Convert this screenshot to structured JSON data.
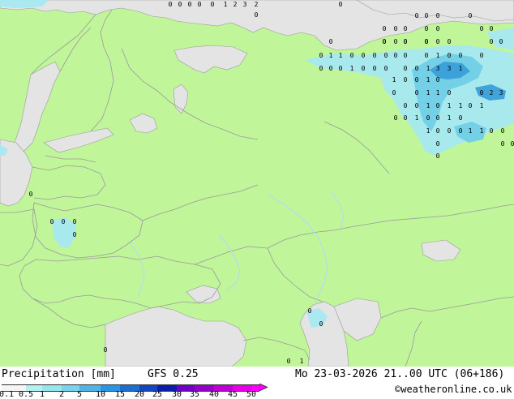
{
  "map": {
    "title": "Precipitation [mm]",
    "model": "GFS 0.25",
    "valid_time": "Mo 23-03-2026 21..00 UTC (06+186)",
    "credit": "©weatheronline.co.uk",
    "colors": {
      "land": "#c0f59a",
      "sea": "#e4e4e4",
      "border": "#9a9a9a",
      "river": "#b4d8ff",
      "precip_light": "#a6e8f2",
      "precip_medium": "#70cfe6",
      "precip_heavy": "#3a9fd8"
    },
    "value_labels": [
      {
        "t": "0"
      },
      {
        "t": "0"
      },
      {
        "t": "0"
      },
      {
        "t": "0"
      },
      {
        "t": "0"
      },
      {
        "t": "1"
      },
      {
        "t": "2"
      },
      {
        "t": "3"
      },
      {
        "t": "2"
      },
      {
        "t": "0"
      },
      {
        "t": "0"
      },
      {
        "t": "0"
      },
      {
        "t": "0"
      },
      {
        "t": "0"
      },
      {
        "t": "0"
      },
      {
        "t": "0"
      },
      {
        "t": "0"
      },
      {
        "t": "0"
      },
      {
        "t": "0"
      },
      {
        "t": "0"
      },
      {
        "t": "0"
      },
      {
        "t": "0"
      },
      {
        "t": "0"
      },
      {
        "t": "0"
      },
      {
        "t": "0"
      },
      {
        "t": "0"
      },
      {
        "t": "0"
      },
      {
        "t": "0"
      },
      {
        "t": "0"
      },
      {
        "t": "0"
      },
      {
        "t": "0"
      },
      {
        "t": "0"
      },
      {
        "t": "0"
      },
      {
        "t": "0"
      },
      {
        "t": "0"
      },
      {
        "t": "1"
      },
      {
        "t": "1"
      },
      {
        "t": "0"
      },
      {
        "t": "0"
      },
      {
        "t": "0"
      },
      {
        "t": "0"
      },
      {
        "t": "0"
      },
      {
        "t": "0"
      },
      {
        "t": "0"
      },
      {
        "t": "1"
      },
      {
        "t": "0"
      },
      {
        "t": "0"
      },
      {
        "t": "0"
      },
      {
        "t": "0"
      },
      {
        "t": "0"
      },
      {
        "t": "0"
      },
      {
        "t": "1"
      },
      {
        "t": "0"
      },
      {
        "t": "0"
      },
      {
        "t": "0"
      },
      {
        "t": "0"
      },
      {
        "t": "0"
      },
      {
        "t": "1"
      },
      {
        "t": "3"
      },
      {
        "t": "3"
      },
      {
        "t": "1"
      },
      {
        "t": "1"
      },
      {
        "t": "0"
      },
      {
        "t": "0"
      },
      {
        "t": "1"
      },
      {
        "t": "0"
      },
      {
        "t": "0"
      },
      {
        "t": "0"
      },
      {
        "t": "1"
      },
      {
        "t": "1"
      },
      {
        "t": "0"
      },
      {
        "t": "0"
      },
      {
        "t": "2"
      },
      {
        "t": "3"
      },
      {
        "t": "0"
      },
      {
        "t": "0"
      },
      {
        "t": "1"
      },
      {
        "t": "0"
      },
      {
        "t": "1"
      },
      {
        "t": "1"
      },
      {
        "t": "0"
      },
      {
        "t": "1"
      },
      {
        "t": "0"
      },
      {
        "t": "0"
      },
      {
        "t": "1"
      },
      {
        "t": "0"
      },
      {
        "t": "0"
      },
      {
        "t": "1"
      },
      {
        "t": "0"
      },
      {
        "t": "1"
      },
      {
        "t": "0"
      },
      {
        "t": "0"
      },
      {
        "t": "0"
      },
      {
        "t": "1"
      },
      {
        "t": "1"
      },
      {
        "t": "0"
      },
      {
        "t": "0"
      },
      {
        "t": "0"
      },
      {
        "t": "0"
      },
      {
        "t": "0"
      },
      {
        "t": "0"
      },
      {
        "t": "0"
      },
      {
        "t": "0"
      },
      {
        "t": "0"
      },
      {
        "t": "0"
      },
      {
        "t": "0"
      },
      {
        "t": "0"
      },
      {
        "t": "0"
      },
      {
        "t": "0"
      },
      {
        "t": "0"
      },
      {
        "t": "1"
      }
    ]
  },
  "legend": {
    "ticks": [
      "0.1",
      "0.5",
      "1",
      "2",
      "5",
      "10",
      "15",
      "20",
      "25",
      "30",
      "35",
      "40",
      "45",
      "50"
    ],
    "colors": [
      "#f5f5f5",
      "#b4f0f0",
      "#96e6f0",
      "#78d2f0",
      "#50b4e6",
      "#2896e6",
      "#1e6ed2",
      "#1446be",
      "#0a1eaa",
      "#6e00c8",
      "#9600c8",
      "#be00d2",
      "#e600e6",
      "#ff00ff"
    ]
  }
}
